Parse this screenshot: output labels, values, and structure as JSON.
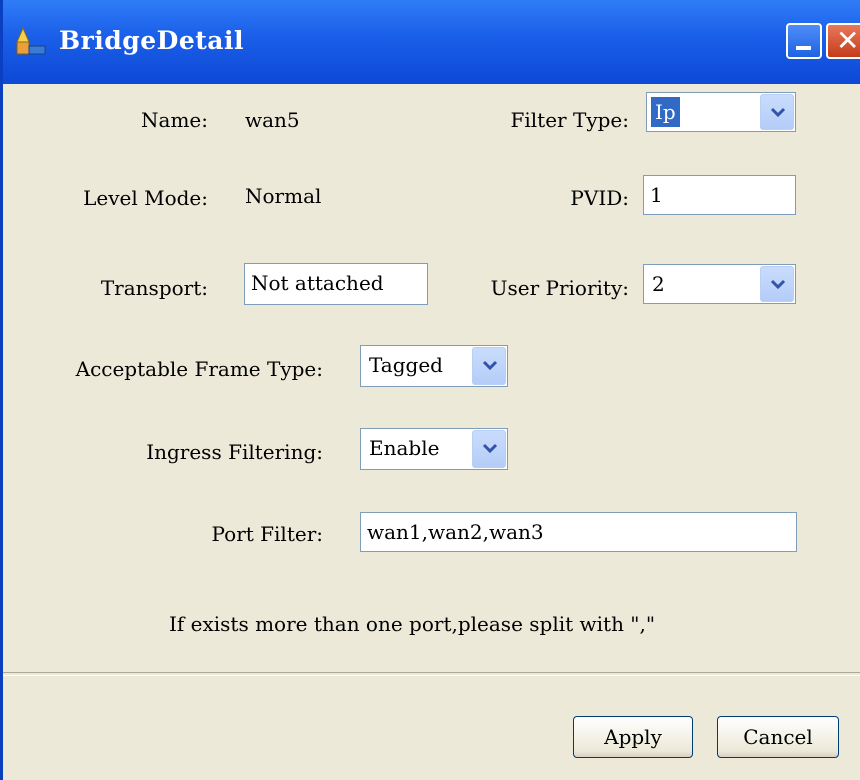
{
  "window": {
    "title": "BridgeDetail"
  },
  "form": {
    "name_label": "Name:",
    "name_value": "wan5",
    "filter_type_label": "Filter Type:",
    "filter_type_value": "Ip",
    "level_mode_label": "Level Mode:",
    "level_mode_value": "Normal",
    "pvid_label": "PVID:",
    "pvid_value": "1",
    "transport_label": "Transport:",
    "transport_value": "Not attached",
    "user_priority_label": "User Priority:",
    "user_priority_value": "2",
    "acceptable_frame_type_label": "Acceptable Frame Type:",
    "acceptable_frame_type_value": "Tagged",
    "ingress_filtering_label": "Ingress Filtering:",
    "ingress_filtering_value": "Enable",
    "port_filter_label": "Port Filter:",
    "port_filter_value": "wan1,wan2,wan3",
    "hint": "If exists more than one port,please split with \",\""
  },
  "buttons": {
    "apply": "Apply",
    "cancel": "Cancel"
  },
  "icons": {
    "app": "bridge-app-icon",
    "minimize": "minimize-icon",
    "close": "close-icon",
    "dropdown": "chevron-down-icon"
  },
  "colors": {
    "titlebar": "#0d49d6",
    "dialog_bg": "#ece9d8",
    "selection": "#316ac5",
    "close_button": "#c43c1a"
  }
}
